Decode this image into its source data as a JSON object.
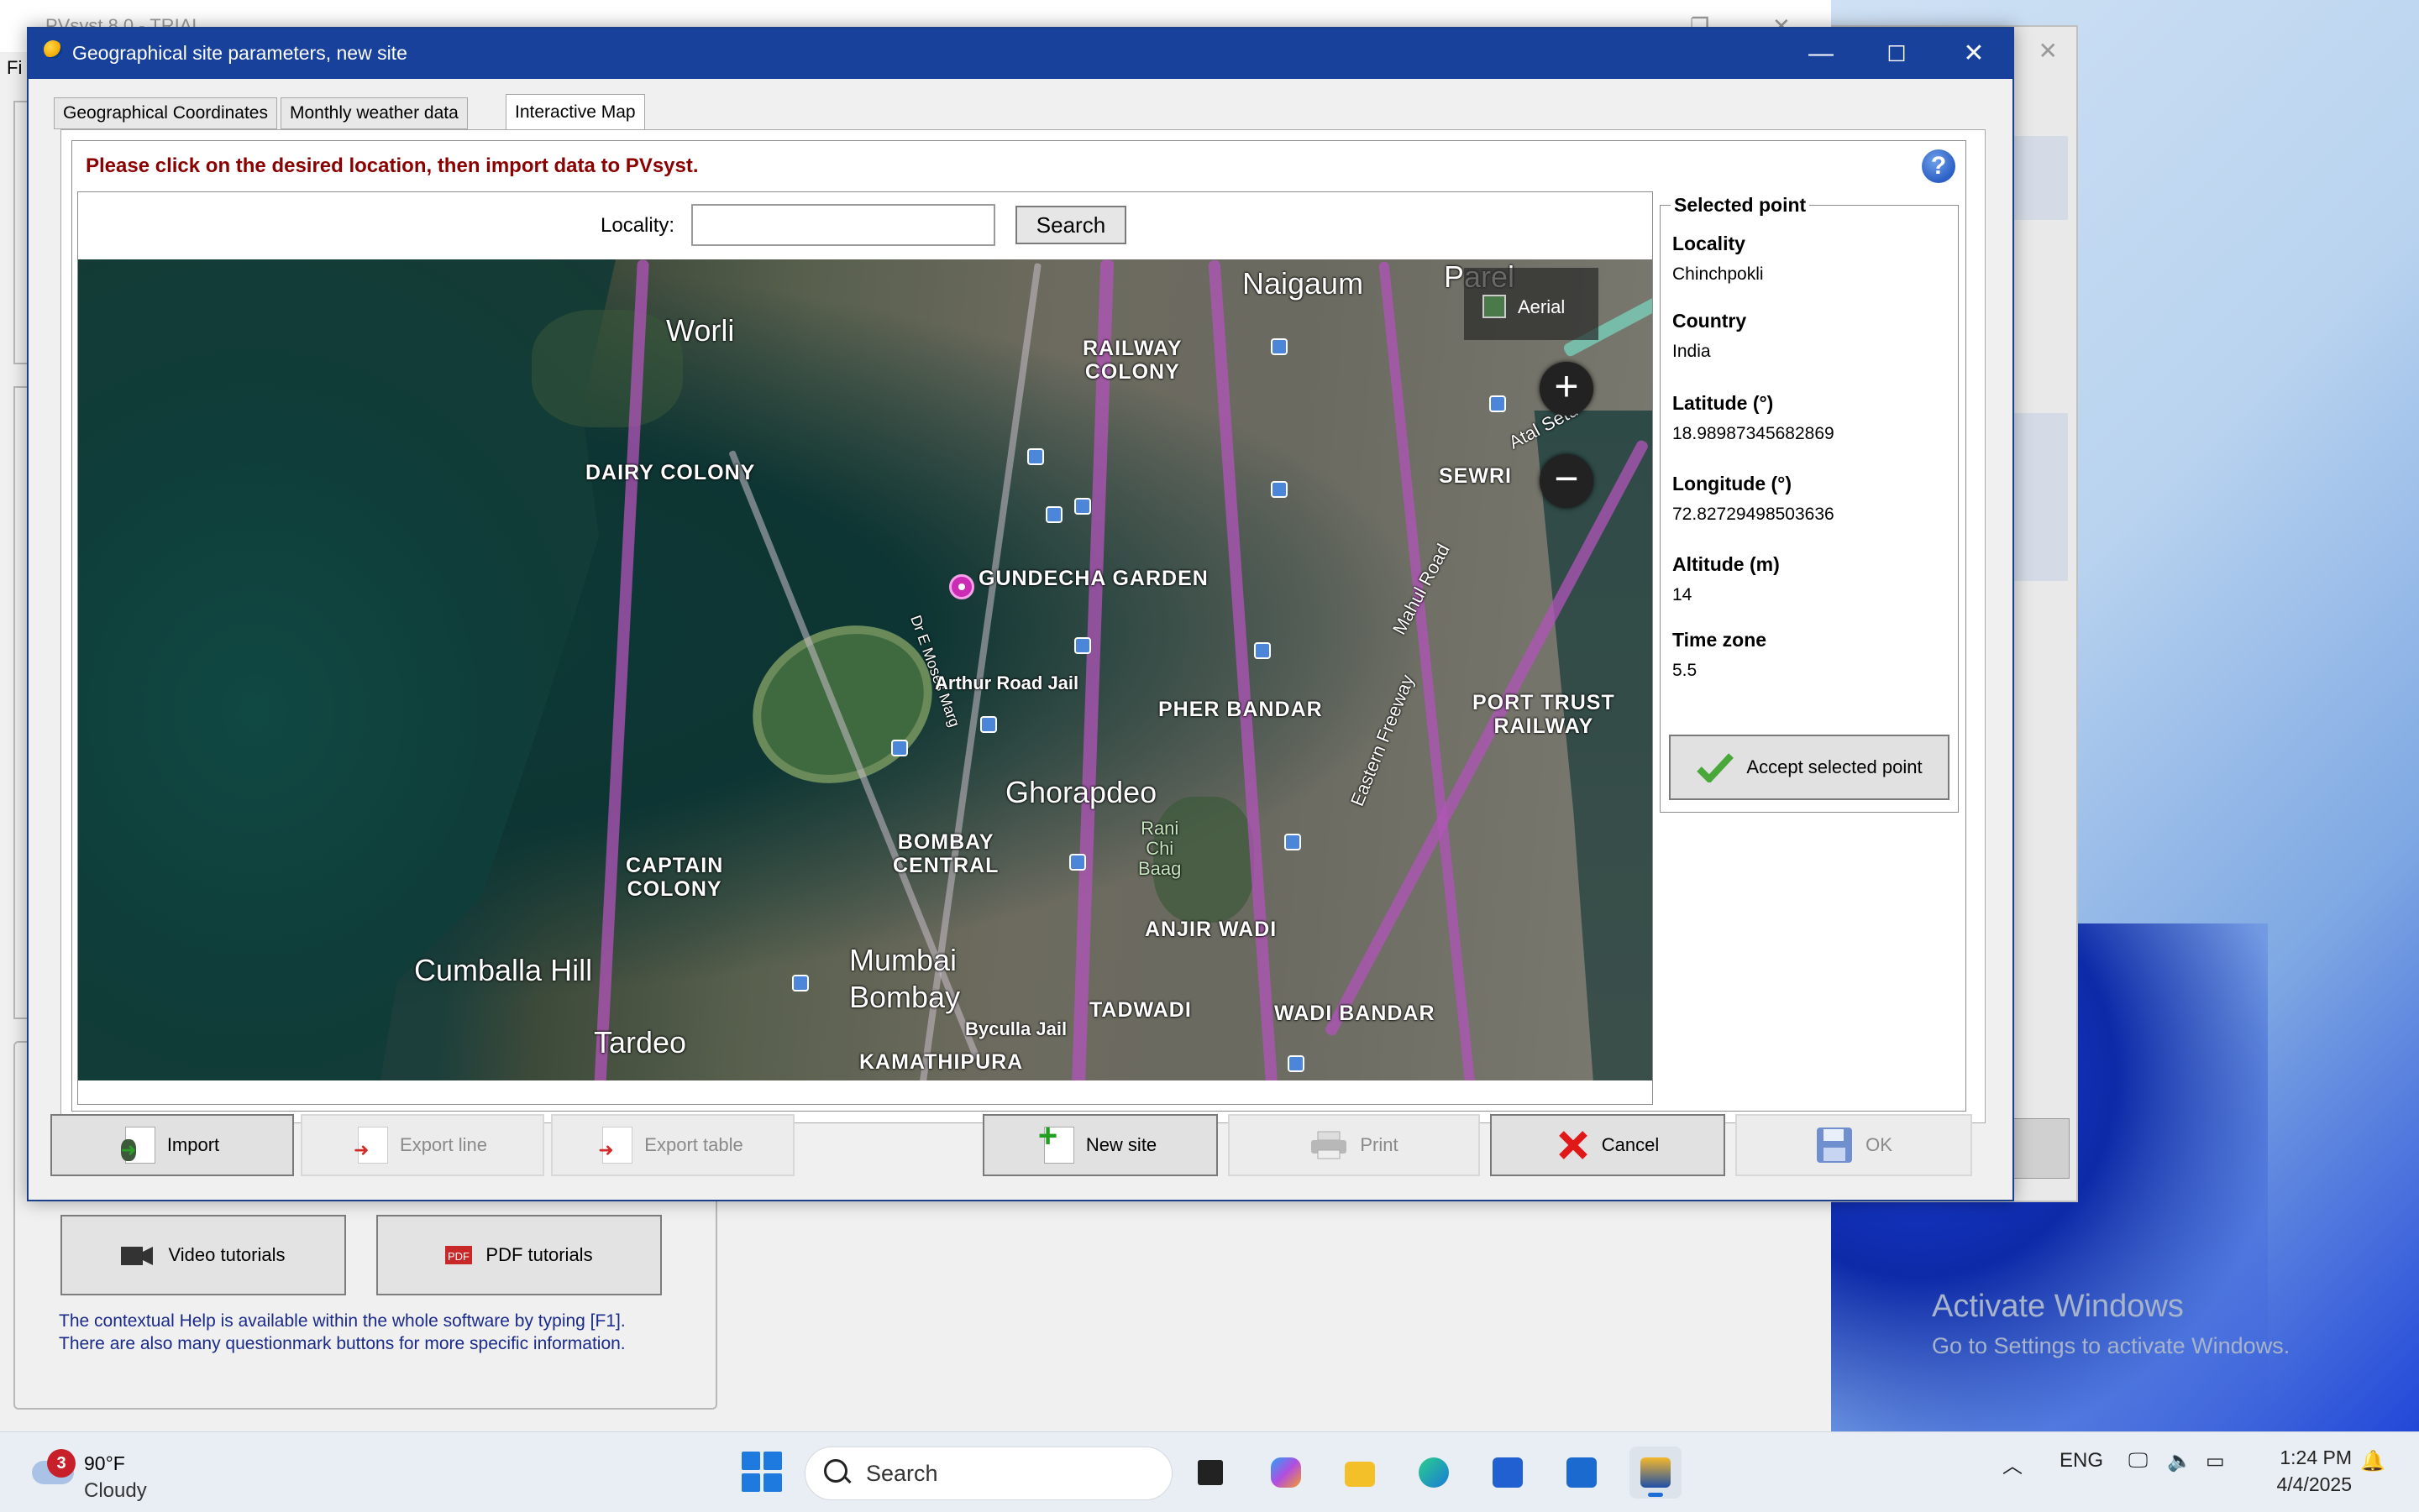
{
  "background_app": {
    "title": "PVsyst 8.0 - TRIAL",
    "menu_first_letters": "Fi",
    "video_tutorials": "Video tutorials",
    "pdf_tutorials": "PDF tutorials",
    "help_line1": "The contextual Help is available within the whole software by typing [F1].",
    "help_line2": "There are also many questionmark buttons for more specific information."
  },
  "activate_windows": {
    "title": "Activate Windows",
    "subtitle": "Go to Settings to activate Windows."
  },
  "dialog": {
    "title": "Geographical site parameters, new site",
    "tabs": [
      {
        "label": "Geographical Coordinates",
        "active": false
      },
      {
        "label": "Monthly weather data",
        "active": false
      },
      {
        "label": "Interactive Map",
        "active": true
      }
    ],
    "instruction": "Please click on the desired location, then import data to PVsyst.",
    "help_icon": "?",
    "locality_label": "Locality:",
    "locality_value": "",
    "search_label": "Search",
    "map": {
      "aerial_label": "Aerial",
      "zoom_in": "+",
      "zoom_out": "−",
      "labels": {
        "naigaum": "Naigaum",
        "parel": "Parel",
        "worli": "Worli",
        "railway_colony": "RAILWAY\nCOLONY",
        "dairy_colony": "DAIRY COLONY",
        "sewri": "SEWRI",
        "atal_setu": "Atal Setu",
        "gundecha_garden": "GUNDECHA GARDEN",
        "mahul_road": "Mahul Road",
        "dr_e_moses": "Dr E Moses Marg",
        "arthur_road_jail": "Arthur Road Jail",
        "pher_bandar": "PHER BANDAR",
        "port_trust": "PORT TRUST\nRAILWAY",
        "eastern_freeway": "Eastern Freeway",
        "ghorapdeo": "Ghorapdeo",
        "bombay_central": "BOMBAY\nCENTRAL",
        "rani_chi_baag": "Rani\nChi\nBaag",
        "captain_colony": "CAPTAIN\nCOLONY",
        "anjir_wadi": "ANJIR WADI",
        "cumballa_hill": "Cumballa Hill",
        "mumbai": "Mumbai",
        "bombay": "Bombay",
        "byculla_jail": "Byculla Jail",
        "tadwadi": "TADWADI",
        "wadi_bandar": "WADI BANDAR",
        "tardeo": "Tardeo",
        "kamathipura": "KAMATHIPURA"
      }
    },
    "selected_point": {
      "legend": "Selected point",
      "locality_label": "Locality",
      "locality": "Chinchpokli",
      "country_label": "Country",
      "country": "India",
      "latitude_label": "Latitude (°)",
      "latitude": "18.98987345682869",
      "longitude_label": "Longitude (°)",
      "longitude": "72.82729498503636",
      "altitude_label": "Altitude (m)",
      "altitude": "14",
      "timezone_label": "Time zone",
      "timezone": "5.5",
      "accept_label": "Accept selected point"
    },
    "buttons": {
      "import": "Import",
      "export_line": "Export line",
      "export_table": "Export table",
      "new_site": "New site",
      "print": "Print",
      "cancel": "Cancel",
      "ok": "OK"
    }
  },
  "taskbar": {
    "weather_badge": "3",
    "temperature": "90°F",
    "condition": "Cloudy",
    "search_placeholder": "Search",
    "language": "ENG",
    "time": "1:24 PM",
    "date": "4/4/2025"
  }
}
